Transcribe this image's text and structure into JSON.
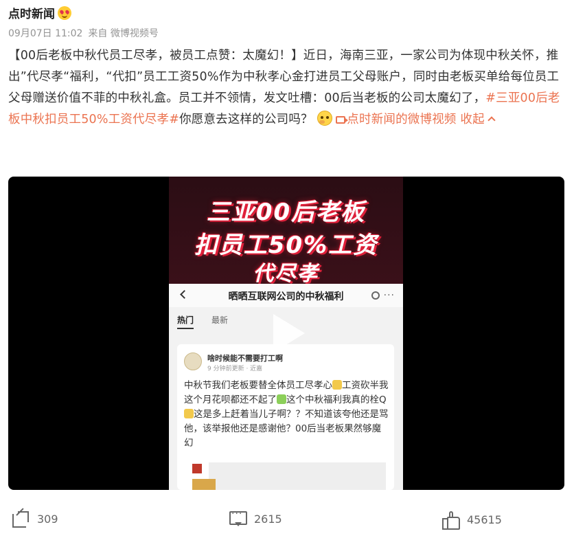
{
  "author": {
    "name": "点时新闻",
    "badge_icon": "heart-eyes-emoji-icon"
  },
  "meta": {
    "date": "09月07日 11:02",
    "source": "来自 微博视频号"
  },
  "post": {
    "text_main": "【00后老板中秋代员工尽孝，被员工点赞：太魔幻！】近日，海南三亚，一家公司为体现中秋关怀，推出”代尽孝“福利，“代扣”员工工资50%作为中秋孝心金打进员工父母账户，同时由老板买单给每位员工父母赠送价值不菲的中秋礼盒。员工并不领情，发文吐槽：00后当老板的公司太魔幻了，",
    "hashtag": "#三亚00后老板中秋扣员工50%工资代尽孝#",
    "text_after": "你愿意去这样的公司吗？",
    "emoji_icon": "thinking-emoji-icon",
    "video_link": "点时新闻的微博视频",
    "collapse": "收起"
  },
  "video": {
    "headline_lines": [
      "三亚00后老板",
      "扣员工50%工资",
      "代尽孝"
    ],
    "phone_title": "晒晒互联网公司的中秋福利",
    "tabs": [
      "热门",
      "最新"
    ],
    "card_user": "啥时候能不需要打工啊",
    "card_time": "9 分钟前更新 · 近嘉",
    "card_text_1": "中秋节我们老板要替全体员工尽孝心",
    "card_text_2": "工资砍半我这个月花呗都还不起了",
    "card_text_3": "这个中秋福利我真的栓Q",
    "card_text_4": "这是多上赶着当儿子啊？？不知道该夸他还是骂他，该举报他还是感谢他？00后当老板果然够魔幻"
  },
  "actions": {
    "share_count": "309",
    "comment_count": "2615",
    "like_count": "45615"
  },
  "colors": {
    "link": "#eb7350",
    "meta": "#939393",
    "headline_glow": "#e0203a"
  }
}
